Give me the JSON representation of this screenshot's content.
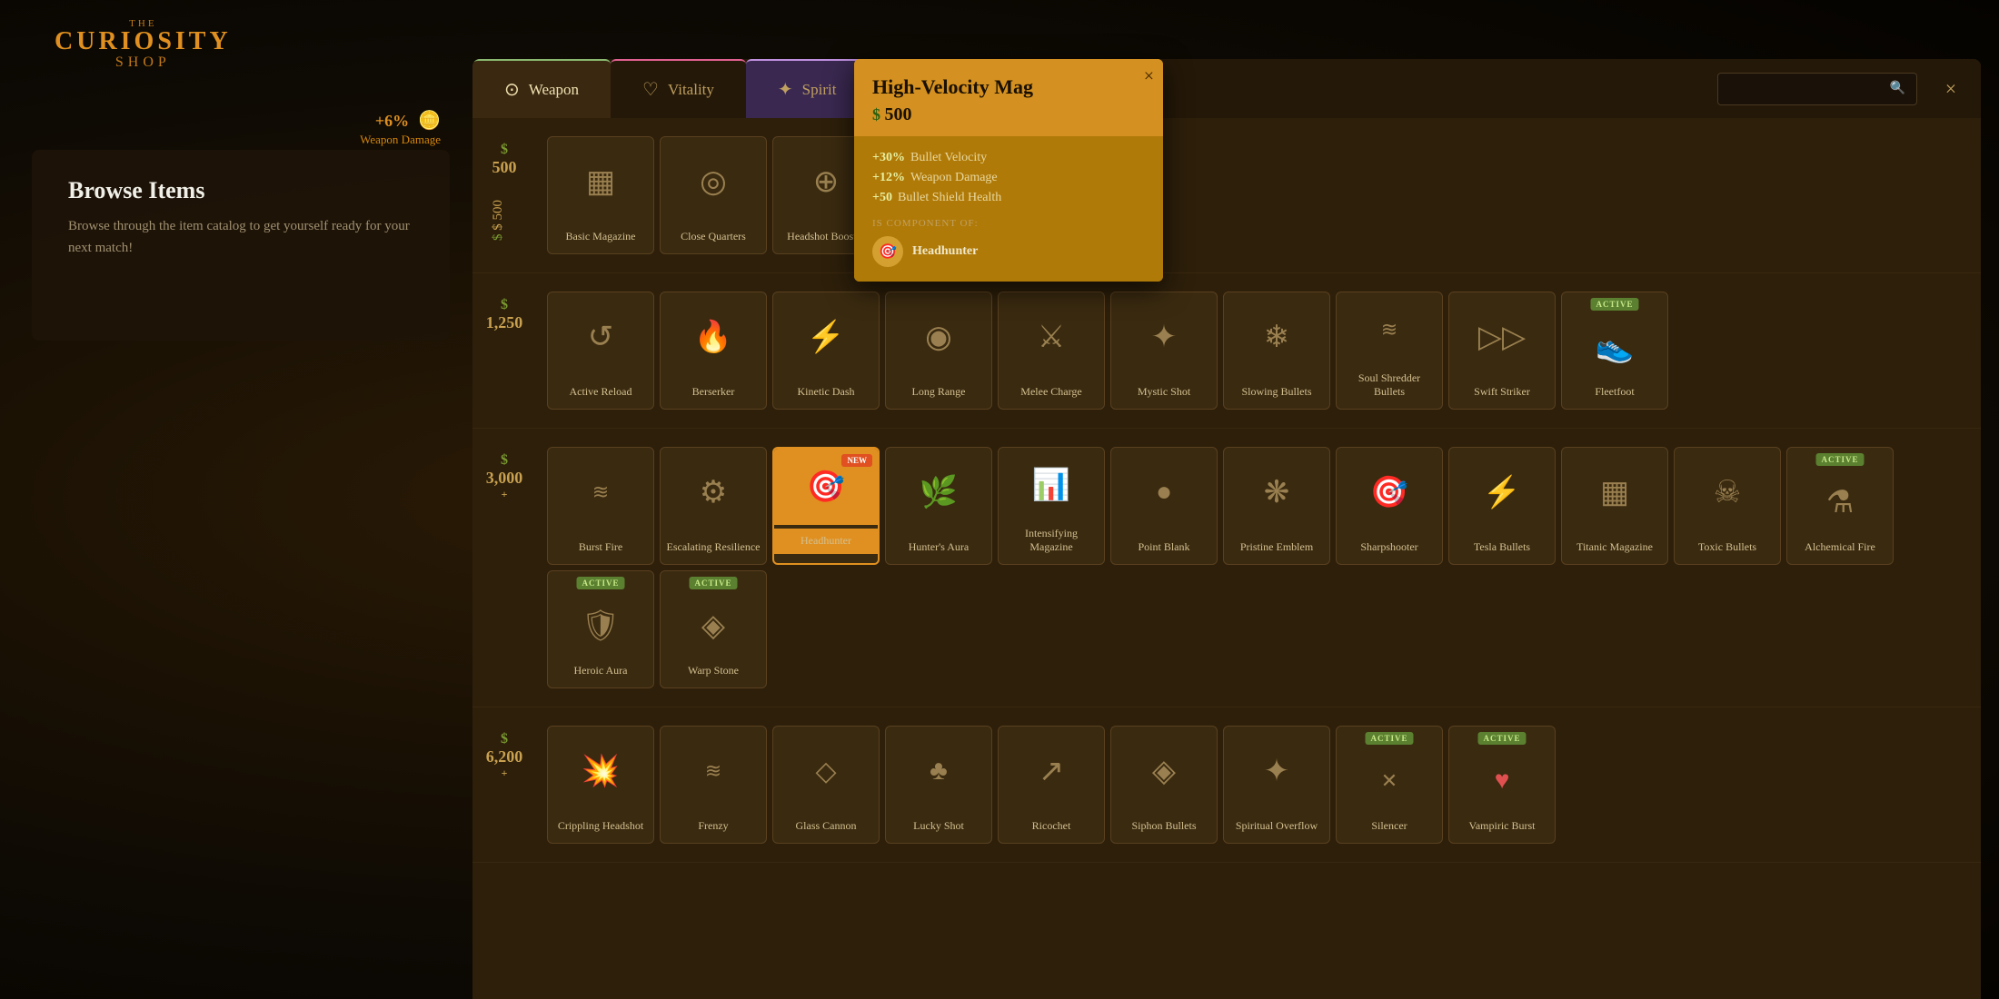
{
  "app": {
    "logo": {
      "the": "THE",
      "curiosity": "CURIOSITY",
      "shop": "SHOP"
    }
  },
  "left_panel": {
    "currency": {
      "amount": "+6%",
      "icon": "coin",
      "label": "Weapon Damage",
      "balance": "$ 500"
    },
    "title": "Browse Items",
    "description": "Browse through the item catalog to get yourself ready for your next match!"
  },
  "tabs": [
    {
      "id": "weapon",
      "label": "Weapon",
      "icon": "⊙",
      "active": true
    },
    {
      "id": "vitality",
      "label": "Vitality",
      "icon": "♡",
      "active": false
    },
    {
      "id": "spirit",
      "label": "Spirit",
      "icon": "✦",
      "active": false
    }
  ],
  "close_button": "×",
  "tooltip": {
    "title": "High-Velocity Mag",
    "price": "500",
    "stats": [
      {
        "plus": "+30%",
        "name": "Bullet Velocity"
      },
      {
        "plus": "+12%",
        "name": "Weapon Damage"
      },
      {
        "plus": "+50",
        "name": "Bullet Shield Health"
      }
    ],
    "component_label": "IS COMPONENT OF:",
    "component": {
      "name": "Headhunter",
      "icon": "🎯"
    }
  },
  "tiers": [
    {
      "id": "500",
      "price": "500",
      "items": [
        {
          "id": "basic-magazine",
          "name": "Basic Magazine",
          "icon": "▦",
          "active": false,
          "new": false
        },
        {
          "id": "close-quarters",
          "name": "Close Quarters",
          "icon": "◎",
          "active": false,
          "new": false
        },
        {
          "id": "headshot-booster",
          "name": "Headshot Booster",
          "icon": "⊕",
          "active": false,
          "new": false
        },
        {
          "id": "high-velocity-mag",
          "name": "High-Velocity Mag",
          "icon": "⋙",
          "active": false,
          "new": false,
          "selected": true
        }
      ]
    },
    {
      "id": "1250",
      "price": "1,250",
      "items": [
        {
          "id": "active-reload",
          "name": "Active Reload",
          "icon": "↺",
          "active": false,
          "new": false
        },
        {
          "id": "berserker",
          "name": "Berserker",
          "icon": "🔥",
          "active": false,
          "new": false
        },
        {
          "id": "kinetic-dash",
          "name": "Kinetic Dash",
          "icon": "⚡",
          "active": false,
          "new": false
        },
        {
          "id": "long-range",
          "name": "Long Range",
          "icon": "◉",
          "active": false,
          "new": false
        },
        {
          "id": "melee-charge",
          "name": "Melee Charge",
          "icon": "⚔",
          "active": false,
          "new": false
        },
        {
          "id": "mystic-shot",
          "name": "Mystic Shot",
          "icon": "✦",
          "active": false,
          "new": false
        },
        {
          "id": "slowing-bullets",
          "name": "Slowing Bullets",
          "icon": "❄",
          "active": false,
          "new": false
        },
        {
          "id": "soul-shredder",
          "name": "Soul Shredder Bullets",
          "icon": "≋",
          "active": false,
          "new": false
        },
        {
          "id": "swift-striker",
          "name": "Swift Striker",
          "icon": "▷▷",
          "active": false,
          "new": false
        },
        {
          "id": "fleetfoot",
          "name": "Fleetfoot",
          "icon": "👟",
          "active": true,
          "new": false
        }
      ]
    },
    {
      "id": "3000",
      "price": "3,000 +",
      "items": [
        {
          "id": "burst-fire",
          "name": "Burst Fire",
          "icon": "≋",
          "active": false,
          "new": false
        },
        {
          "id": "escalating-resilience",
          "name": "Escalating Resilience",
          "icon": "⚙",
          "active": false,
          "new": false
        },
        {
          "id": "headhunter",
          "name": "Headhunter",
          "icon": "🎯",
          "active": false,
          "new": true,
          "selected": false
        },
        {
          "id": "hunters-aura",
          "name": "Hunter's Aura",
          "icon": "🌿",
          "active": false,
          "new": false
        },
        {
          "id": "intensifying-magazine",
          "name": "Intensifying Magazine",
          "icon": "📊",
          "active": false,
          "new": false
        },
        {
          "id": "point-blank",
          "name": "Point Blank",
          "icon": "●",
          "active": false,
          "new": false
        },
        {
          "id": "pristine-emblem",
          "name": "Pristine Emblem",
          "icon": "❋",
          "active": false,
          "new": false
        },
        {
          "id": "sharpshooter",
          "name": "Sharpshooter",
          "icon": "🎯",
          "active": false,
          "new": false
        },
        {
          "id": "tesla-bullets",
          "name": "Tesla Bullets",
          "icon": "⚡",
          "active": false,
          "new": false
        },
        {
          "id": "titanic-magazine",
          "name": "Titanic Magazine",
          "icon": "▦",
          "active": false,
          "new": false
        },
        {
          "id": "toxic-bullets",
          "name": "Toxic Bullets",
          "icon": "☠",
          "active": false,
          "new": false
        },
        {
          "id": "alchemical-fire",
          "name": "Alchemical Fire",
          "icon": "⚗",
          "active": true,
          "new": false
        },
        {
          "id": "heroic-aura",
          "name": "Heroic Aura",
          "icon": "🛡",
          "active": true,
          "new": false
        },
        {
          "id": "warp-stone",
          "name": "Warp Stone",
          "icon": "◈",
          "active": true,
          "new": false
        }
      ]
    },
    {
      "id": "6200",
      "price": "6,200 +",
      "items": [
        {
          "id": "crippling-headshot",
          "name": "Crippling Headshot",
          "icon": "💥",
          "active": false,
          "new": false
        },
        {
          "id": "frenzy",
          "name": "Frenzy",
          "icon": "≋",
          "active": false,
          "new": false
        },
        {
          "id": "glass-cannon",
          "name": "Glass Cannon",
          "icon": "◇",
          "active": false,
          "new": false
        },
        {
          "id": "lucky-shot",
          "name": "Lucky Shot",
          "icon": "♣",
          "active": false,
          "new": false
        },
        {
          "id": "ricochet",
          "name": "Ricochet",
          "icon": "↗",
          "active": false,
          "new": false
        },
        {
          "id": "siphon-bullets",
          "name": "Siphon Bullets",
          "icon": "◈",
          "active": false,
          "new": false
        },
        {
          "id": "spiritual-overflow",
          "name": "Spiritual Overflow",
          "icon": "✦",
          "active": false,
          "new": false
        },
        {
          "id": "silencer",
          "name": "Silencer",
          "icon": "✕",
          "active": true,
          "new": false
        },
        {
          "id": "vampiric-burst",
          "name": "Vampiric Burst",
          "icon": "♥",
          "active": true,
          "new": false
        }
      ]
    }
  ]
}
